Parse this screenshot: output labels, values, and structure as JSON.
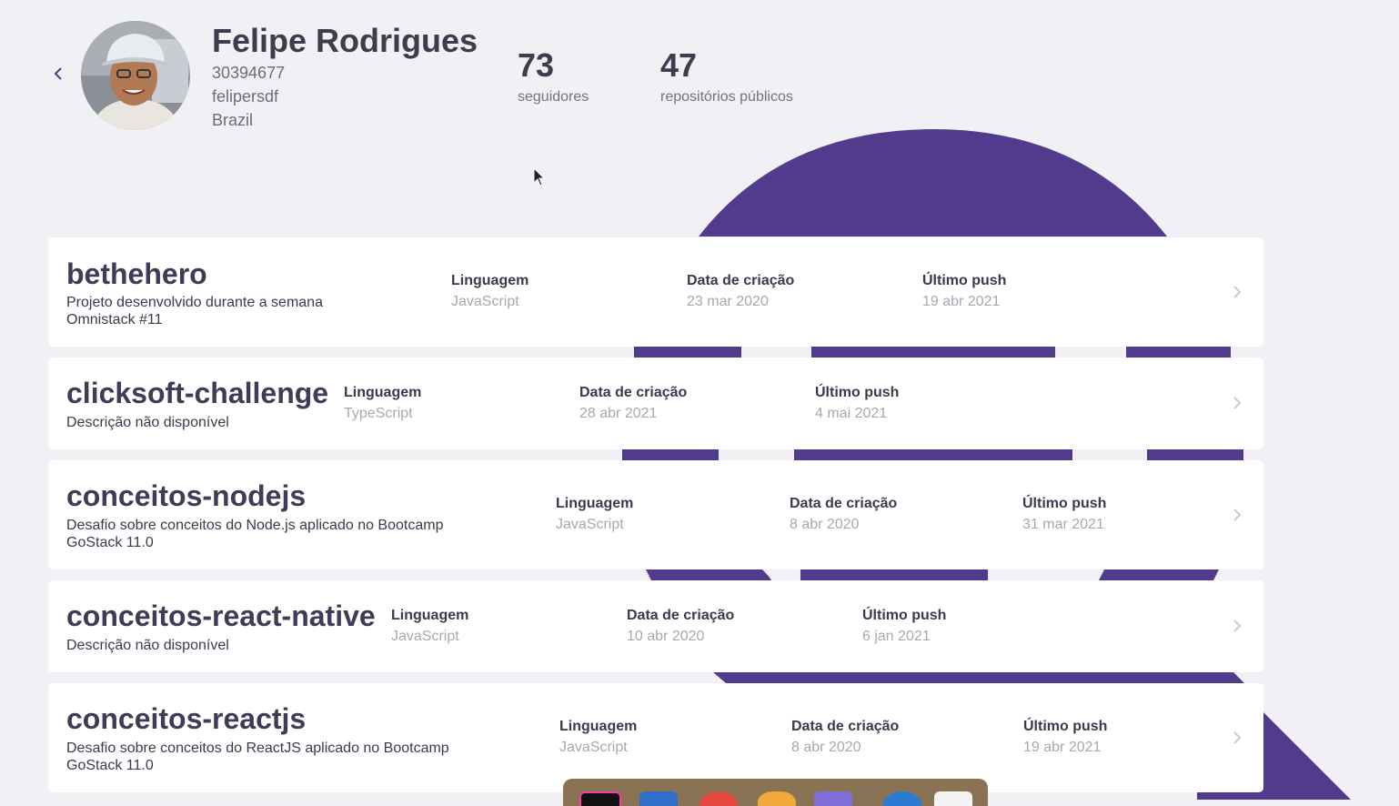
{
  "user": {
    "name": "Felipe Rodrigues",
    "id": "30394677",
    "login": "felipersdf",
    "location": "Brazil"
  },
  "stats": {
    "followers_count": "73",
    "followers_label": "seguidores",
    "repos_count": "47",
    "repos_label": "repositórios públicos"
  },
  "labels": {
    "language": "Linguagem",
    "created": "Data de criação",
    "pushed": "Último push"
  },
  "repos": [
    {
      "name": "bethehero",
      "description": "Projeto desenvolvido durante a semana Omnistack #11",
      "language": "JavaScript",
      "created": "23 mar 2020",
      "pushed": "19 abr 2021"
    },
    {
      "name": "clicksoft-challenge",
      "description": "Descrição não disponível",
      "language": "TypeScript",
      "created": "28 abr 2021",
      "pushed": "4 mai 2021"
    },
    {
      "name": "conceitos-nodejs",
      "description": "Desafio sobre conceitos do Node.js aplicado no Bootcamp GoStack 11.0",
      "language": "JavaScript",
      "created": "8 abr 2020",
      "pushed": "31 mar 2021"
    },
    {
      "name": "conceitos-react-native",
      "description": "Descrição não disponível",
      "language": "JavaScript",
      "created": "10 abr 2020",
      "pushed": "6 jan 2021"
    },
    {
      "name": "conceitos-reactjs",
      "description": "Desafio sobre conceitos do ReactJS aplicado no Bootcamp GoStack 11.0",
      "language": "JavaScript",
      "created": "8 abr 2020",
      "pushed": "19 abr 2021"
    }
  ],
  "icons": {
    "back": "chevron-left-icon",
    "card_arrow": "chevron-right-icon",
    "cursor": "mouse-pointer-icon"
  },
  "colors": {
    "brand": "#523a8c",
    "background": "#f0f0f5",
    "card": "#ffffff",
    "heading": "#3d3d4d",
    "muted": "#a8a8b3"
  }
}
